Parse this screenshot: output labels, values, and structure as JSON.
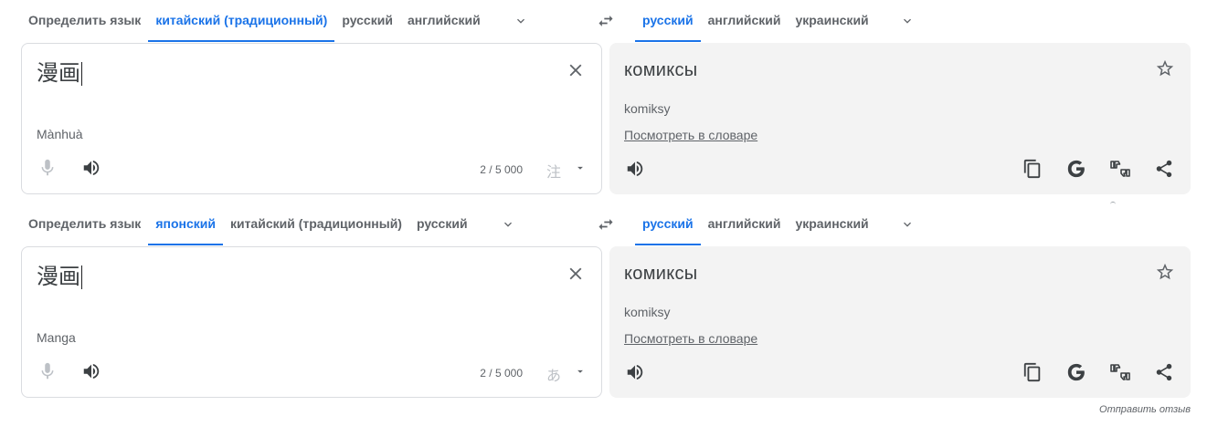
{
  "block1": {
    "source_langs": [
      {
        "label": "Определить язык",
        "active": false
      },
      {
        "label": "китайский (традиционный)",
        "active": true
      },
      {
        "label": "русский",
        "active": false
      },
      {
        "label": "английский",
        "active": false
      }
    ],
    "target_langs": [
      {
        "label": "русский",
        "active": true
      },
      {
        "label": "английский",
        "active": false
      },
      {
        "label": "украинский",
        "active": false
      }
    ],
    "source_text": "漫画",
    "source_transliteration": "Mànhuà",
    "char_counter": "2 / 5 000",
    "ime_glyph": "注",
    "translation": "комиксы",
    "translation_transliteration": "komiksy",
    "dictionary_link": "Посмотреть в словаре"
  },
  "block2": {
    "source_langs": [
      {
        "label": "Определить язык",
        "active": false
      },
      {
        "label": "японский",
        "active": true
      },
      {
        "label": "китайский (традиционный)",
        "active": false
      },
      {
        "label": "русский",
        "active": false
      }
    ],
    "target_langs": [
      {
        "label": "русский",
        "active": true
      },
      {
        "label": "английский",
        "active": false
      },
      {
        "label": "украинский",
        "active": false
      }
    ],
    "source_text": "漫画",
    "source_transliteration": "Manga",
    "char_counter": "2 / 5 000",
    "ime_glyph": "あ",
    "translation": "комиксы",
    "translation_transliteration": "komiksy",
    "dictionary_link": "Посмотреть в словаре"
  },
  "feedback_link": "Отправить отзыв",
  "colors": {
    "accent": "#1a73e8",
    "text": "#3c4043",
    "muted": "#5f6368",
    "panel_bg": "#f3f3f3"
  }
}
